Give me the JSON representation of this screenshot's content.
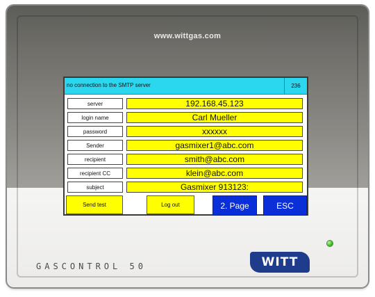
{
  "device": {
    "url": "www.wittgas.com",
    "brand": "GASCONTROL 50",
    "logo_text": "WITT"
  },
  "status": {
    "message": "no connection to the SMTP server",
    "code": "236"
  },
  "fields": [
    {
      "label": "server",
      "value": "192.168.45.123"
    },
    {
      "label": "login name",
      "value": "Carl Mueller"
    },
    {
      "label": "password",
      "value": "xxxxxx"
    },
    {
      "label": "Sender",
      "value": "gasmixer1@abc.com"
    },
    {
      "label": "recipient",
      "value": "smith@abc.com"
    },
    {
      "label": "recipient CC",
      "value": "klein@abc.com"
    },
    {
      "label": "subject",
      "value": "Gasmixer 913123:"
    }
  ],
  "buttons": {
    "send_test": "Send test",
    "log_out": "Log out",
    "page2": "2. Page",
    "esc": "ESC"
  },
  "colors": {
    "status_bar": "#2ad7ef",
    "field": "#ffff00",
    "blue_button": "#0a2fd8",
    "led": "#31b816"
  }
}
